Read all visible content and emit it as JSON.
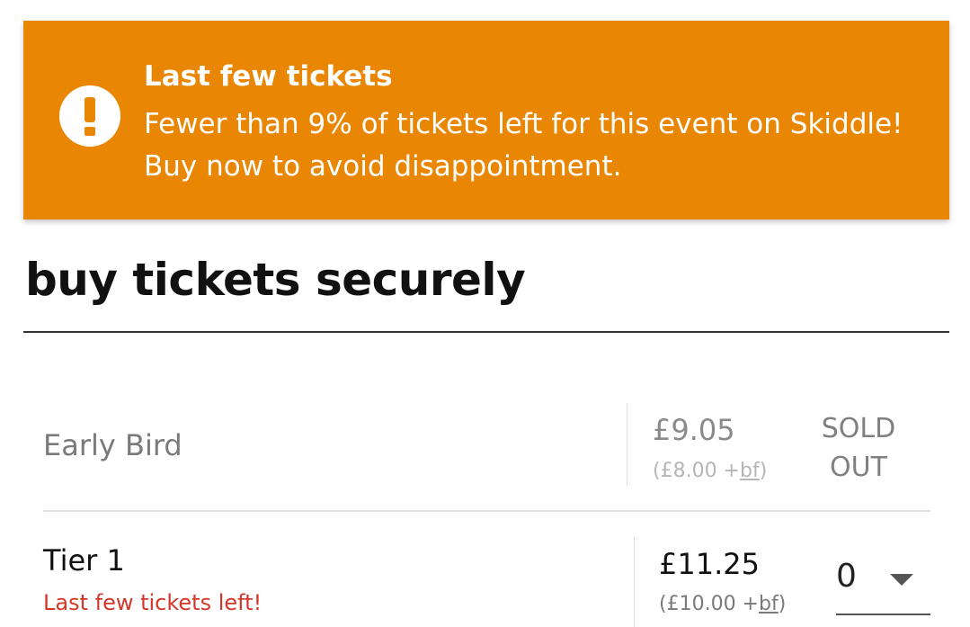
{
  "banner": {
    "icon": "exclamation-circle-icon",
    "title": "Last few tickets",
    "message": "Fewer than 9% of tickets left for this event on Skiddle! Buy now to avoid disappointment.",
    "background_color": "#e98603"
  },
  "page_title": "buy tickets securely",
  "tickets": [
    {
      "name": "Early Bird",
      "price": "£9.05",
      "base_price": "(£8.00 +",
      "fee_label": "bf",
      "base_price_close": ")",
      "status": "SOLD OUT"
    },
    {
      "name": "Tier 1",
      "warning": "Last few tickets left!",
      "price": "£11.25",
      "base_price": "(£10.00 +",
      "fee_label": "bf",
      "base_price_close": ")",
      "quantity": "0"
    }
  ],
  "colors": {
    "warning_text": "#d2372a",
    "muted_text": "#808080"
  }
}
